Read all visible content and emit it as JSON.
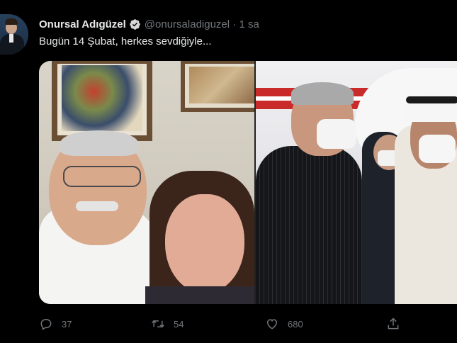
{
  "tweet": {
    "author_name": "Onursal Adıgüzel",
    "handle": "@onursaladiguzel",
    "separator": " · ",
    "time": "1 sa",
    "text": "Bugün 14 Şubat, herkes sevdiğiyle...",
    "verified_icon": "verified-badge-icon"
  },
  "actions": {
    "reply_count": "37",
    "retweet_count": "54",
    "like_count": "680",
    "reply_icon": "reply-icon",
    "retweet_icon": "retweet-icon",
    "like_icon": "heart-icon",
    "share_icon": "share-icon"
  },
  "colors": {
    "background": "#000000",
    "primary_text": "#e7e9ea",
    "secondary_text": "#71767b",
    "verified": "#d9d9d9"
  }
}
